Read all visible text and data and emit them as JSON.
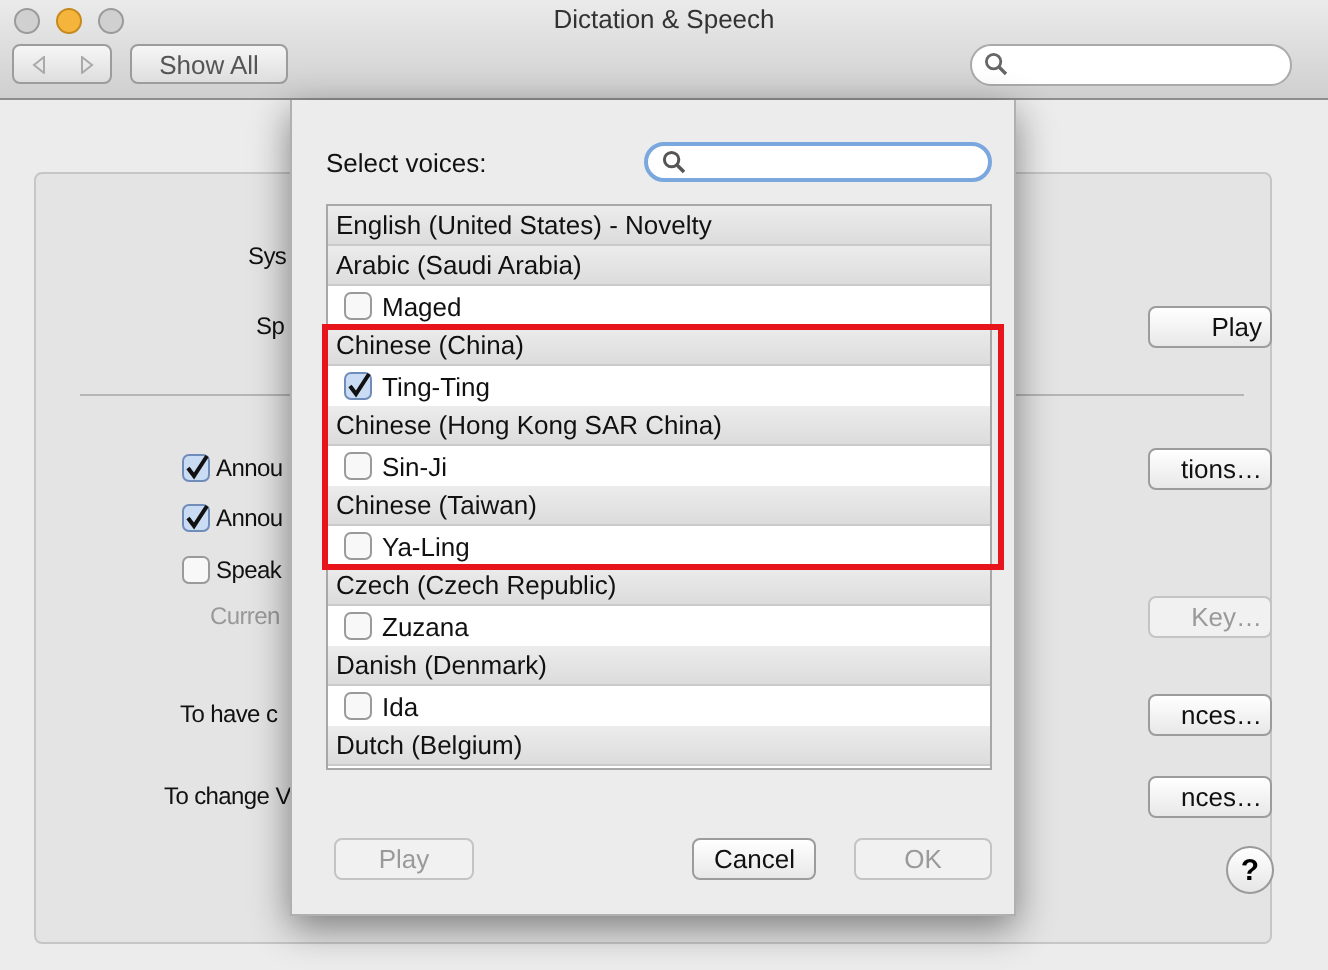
{
  "window": {
    "title": "Dictation & Speech",
    "show_all": "Show All"
  },
  "background": {
    "rows": [
      {
        "kind": "label",
        "label": "Sys"
      },
      {
        "kind": "label",
        "label": "Sp",
        "button": "Play",
        "disabled": false
      },
      {
        "kind": "divider"
      },
      {
        "kind": "check",
        "checked": true,
        "label": "Annou",
        "button": "tions…",
        "disabled": false
      },
      {
        "kind": "check",
        "checked": true,
        "label": "Annou"
      },
      {
        "kind": "check",
        "checked": false,
        "label": "Speak"
      },
      {
        "kind": "label",
        "label": "Curren",
        "button": "Key…",
        "disabled": true
      },
      {
        "kind": "label",
        "label": "To have c",
        "button": "nces…",
        "disabled": false
      },
      {
        "kind": "label",
        "label": "To change V",
        "button": "nces…",
        "disabled": false
      }
    ],
    "help": "?"
  },
  "sheet": {
    "label": "Select voices:",
    "groups": [
      {
        "name": "English (United States) - Novelty"
      },
      {
        "name": "Arabic (Saudi Arabia)",
        "voices": [
          {
            "name": "Maged",
            "checked": false
          }
        ]
      },
      {
        "name": "Chinese (China)",
        "voices": [
          {
            "name": "Ting-Ting",
            "checked": true
          }
        ]
      },
      {
        "name": "Chinese (Hong Kong SAR China)",
        "voices": [
          {
            "name": "Sin-Ji",
            "checked": false
          }
        ]
      },
      {
        "name": "Chinese (Taiwan)",
        "voices": [
          {
            "name": "Ya-Ling",
            "checked": false
          }
        ]
      },
      {
        "name": "Czech (Czech Republic)",
        "voices": [
          {
            "name": "Zuzana",
            "checked": false
          }
        ]
      },
      {
        "name": "Danish (Denmark)",
        "voices": [
          {
            "name": "Ida",
            "checked": false
          }
        ]
      },
      {
        "name": "Dutch (Belgium)"
      }
    ],
    "buttons": [
      {
        "label": "Play",
        "disabled": true
      },
      {
        "label": "Cancel",
        "disabled": false
      },
      {
        "label": "OK",
        "disabled": true
      }
    ]
  }
}
